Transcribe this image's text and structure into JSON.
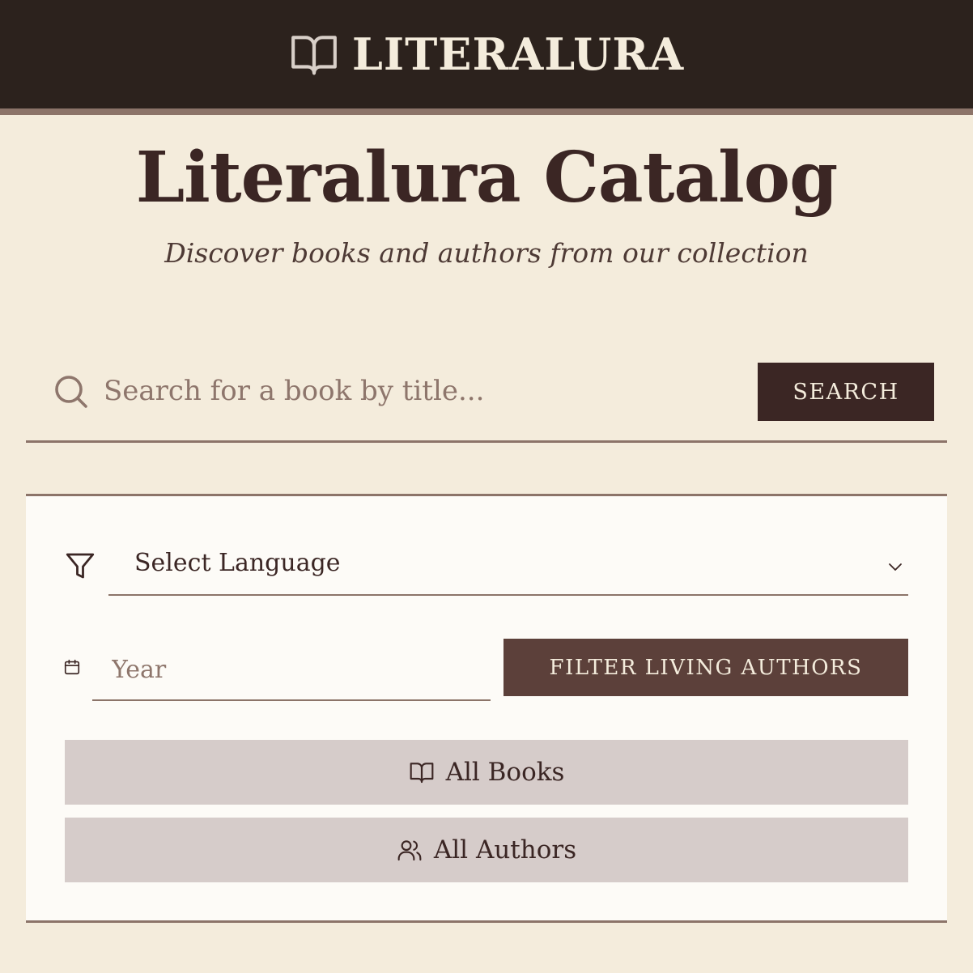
{
  "header": {
    "brand_name": "LITERALURA",
    "brand_icon": "open-book-icon"
  },
  "hero": {
    "title": "Literalura Catalog",
    "subtitle": "Discover books and authors from our collection"
  },
  "search": {
    "placeholder": "Search for a book by title...",
    "value": "",
    "button_label": "SEARCH",
    "icon": "search-icon"
  },
  "filters": {
    "language": {
      "selected_label": "Select Language",
      "icon": "filter-icon"
    },
    "year": {
      "placeholder": "Year",
      "value": "",
      "icon": "calendar-icon"
    },
    "living_authors_button": "FILTER LIVING AUTHORS"
  },
  "actions": {
    "all_books": {
      "label": "All Books",
      "icon": "book-icon"
    },
    "all_authors": {
      "label": "All Authors",
      "icon": "users-icon"
    }
  },
  "colors": {
    "background": "#f4ecdc",
    "header": "#2c221d",
    "accent_dark": "#3b2624",
    "accent_mid": "#5c403a",
    "rule": "#8c7469",
    "panel": "#fdfbf7",
    "button_muted": "#d6ccca"
  }
}
